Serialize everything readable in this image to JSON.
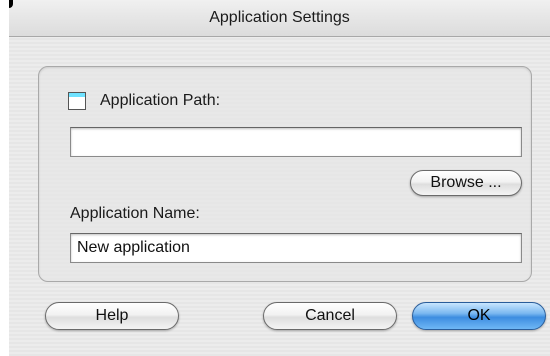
{
  "window": {
    "title": "Application Settings"
  },
  "application_path": {
    "label": "Application Path:",
    "value": "",
    "checked": false
  },
  "browse_button": {
    "label": "Browse ..."
  },
  "application_name": {
    "label": "Application Name:",
    "value": "New application"
  },
  "buttons": {
    "help": "Help",
    "cancel": "Cancel",
    "ok": "OK"
  },
  "colors": {
    "ok_button": "#3d8de0",
    "checkbox_header": "#6fe2ff"
  }
}
